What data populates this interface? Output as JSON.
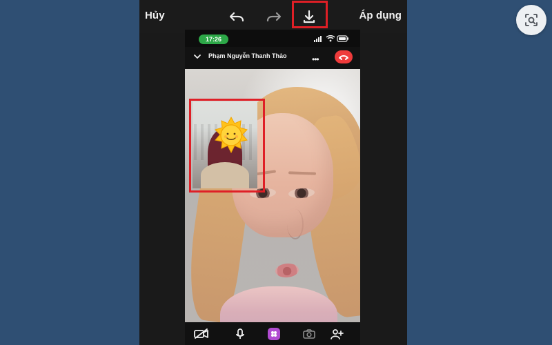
{
  "top_bar": {
    "cancel_label": "Hủy",
    "apply_label": "Áp dụng"
  },
  "status_bar": {
    "time": "17:26"
  },
  "call": {
    "contact_name": "Phạm Nguyễn Thanh Thảo",
    "more_label": "•••"
  },
  "colors": {
    "background": "#2f4f73",
    "highlight": "#df1f26",
    "end_call": "#ef3b3b",
    "time_pill": "#2da848"
  },
  "icons": {
    "undo": "undo-icon",
    "redo": "redo-icon",
    "download": "download-icon",
    "video_off": "video-off-icon",
    "microphone": "microphone-icon",
    "effects": "effects-icon",
    "camera": "camera-icon",
    "add_user": "add-user-icon",
    "screen_capture": "screen-capture-icon"
  }
}
